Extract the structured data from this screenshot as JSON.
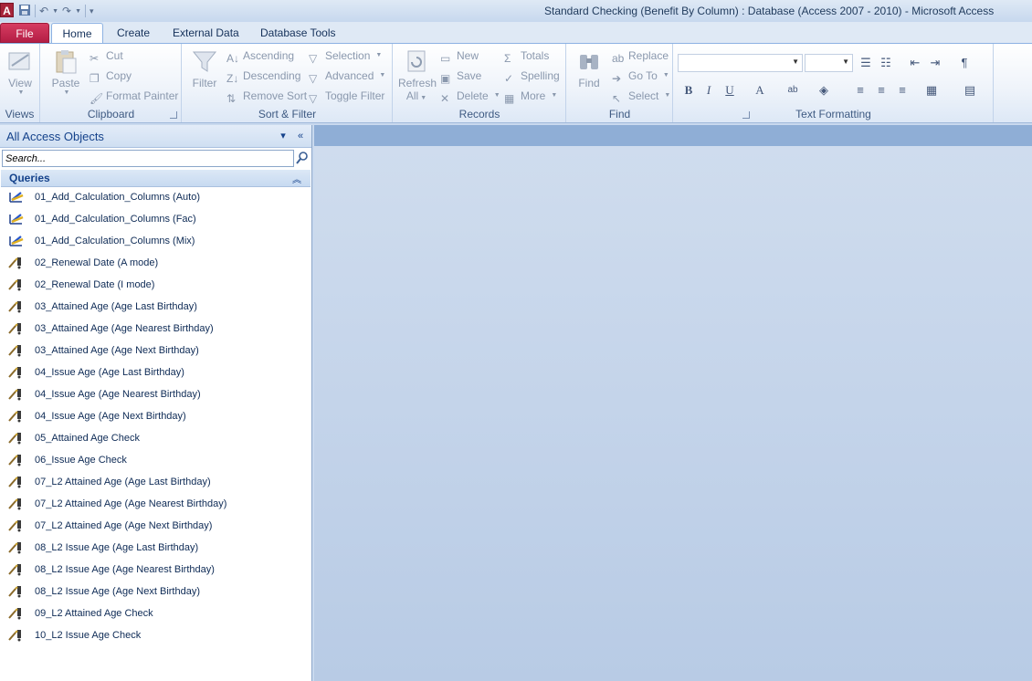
{
  "window": {
    "title": "Standard Checking (Benefit By Column) : Database (Access 2007 - 2010)  -  Microsoft Access",
    "app_icon_letter": "A"
  },
  "tabs": [
    {
      "label": "File"
    },
    {
      "label": "Home"
    },
    {
      "label": "Create"
    },
    {
      "label": "External Data"
    },
    {
      "label": "Database Tools"
    }
  ],
  "ribbon": {
    "views": {
      "label": "Views",
      "view": "View"
    },
    "clipboard": {
      "label": "Clipboard",
      "paste": "Paste",
      "cut": "Cut",
      "copy": "Copy",
      "format_painter": "Format Painter"
    },
    "sort_filter": {
      "label": "Sort & Filter",
      "filter": "Filter",
      "ascending": "Ascending",
      "descending": "Descending",
      "remove_sort": "Remove Sort",
      "selection": "Selection",
      "advanced": "Advanced",
      "toggle_filter": "Toggle Filter"
    },
    "records": {
      "label": "Records",
      "refresh": "Refresh",
      "refresh_all": "All",
      "new": "New",
      "save": "Save",
      "delete": "Delete",
      "totals": "Totals",
      "spelling": "Spelling",
      "more": "More"
    },
    "find": {
      "label": "Find",
      "find": "Find",
      "replace": "Replace",
      "go_to": "Go To",
      "select": "Select"
    },
    "text_formatting": {
      "label": "Text Formatting",
      "bold": "B",
      "italic": "I",
      "underline": "U",
      "font_color": "A"
    }
  },
  "nav": {
    "title": "All Access Objects",
    "search_placeholder": "Search...",
    "group": "Queries",
    "items": [
      {
        "label": "01_Add_Calculation_Columns (Auto)",
        "icon": "update-query-icon"
      },
      {
        "label": "01_Add_Calculation_Columns (Fac)",
        "icon": "update-query-icon"
      },
      {
        "label": "01_Add_Calculation_Columns (Mix)",
        "icon": "update-query-icon"
      },
      {
        "label": "02_Renewal Date (A mode)",
        "icon": "select-query-icon"
      },
      {
        "label": "02_Renewal Date (I mode)",
        "icon": "select-query-icon"
      },
      {
        "label": "03_Attained Age (Age Last Birthday)",
        "icon": "select-query-icon"
      },
      {
        "label": "03_Attained Age (Age Nearest Birthday)",
        "icon": "select-query-icon"
      },
      {
        "label": "03_Attained Age (Age Next Birthday)",
        "icon": "select-query-icon"
      },
      {
        "label": "04_Issue Age (Age Last Birthday)",
        "icon": "select-query-icon"
      },
      {
        "label": "04_Issue Age (Age Nearest Birthday)",
        "icon": "select-query-icon"
      },
      {
        "label": "04_Issue Age (Age Next Birthday)",
        "icon": "select-query-icon"
      },
      {
        "label": "05_Attained Age Check",
        "icon": "select-query-icon"
      },
      {
        "label": "06_Issue Age Check",
        "icon": "select-query-icon"
      },
      {
        "label": "07_L2 Attained Age (Age Last Birthday)",
        "icon": "select-query-icon"
      },
      {
        "label": "07_L2 Attained Age (Age Nearest Birthday)",
        "icon": "select-query-icon"
      },
      {
        "label": "07_L2 Attained Age (Age Next Birthday)",
        "icon": "select-query-icon"
      },
      {
        "label": "08_L2 Issue Age (Age Last Birthday)",
        "icon": "select-query-icon"
      },
      {
        "label": "08_L2 Issue Age (Age Nearest Birthday)",
        "icon": "select-query-icon"
      },
      {
        "label": "08_L2 Issue Age (Age Next Birthday)",
        "icon": "select-query-icon"
      },
      {
        "label": "09_L2 Attained Age Check",
        "icon": "select-query-icon"
      },
      {
        "label": "10_L2 Issue Age Check",
        "icon": "select-query-icon"
      }
    ]
  },
  "colors": {
    "file_tab": "#b41e45",
    "ribbon_text": "#15428b",
    "workspace": "#c4d4ea"
  }
}
